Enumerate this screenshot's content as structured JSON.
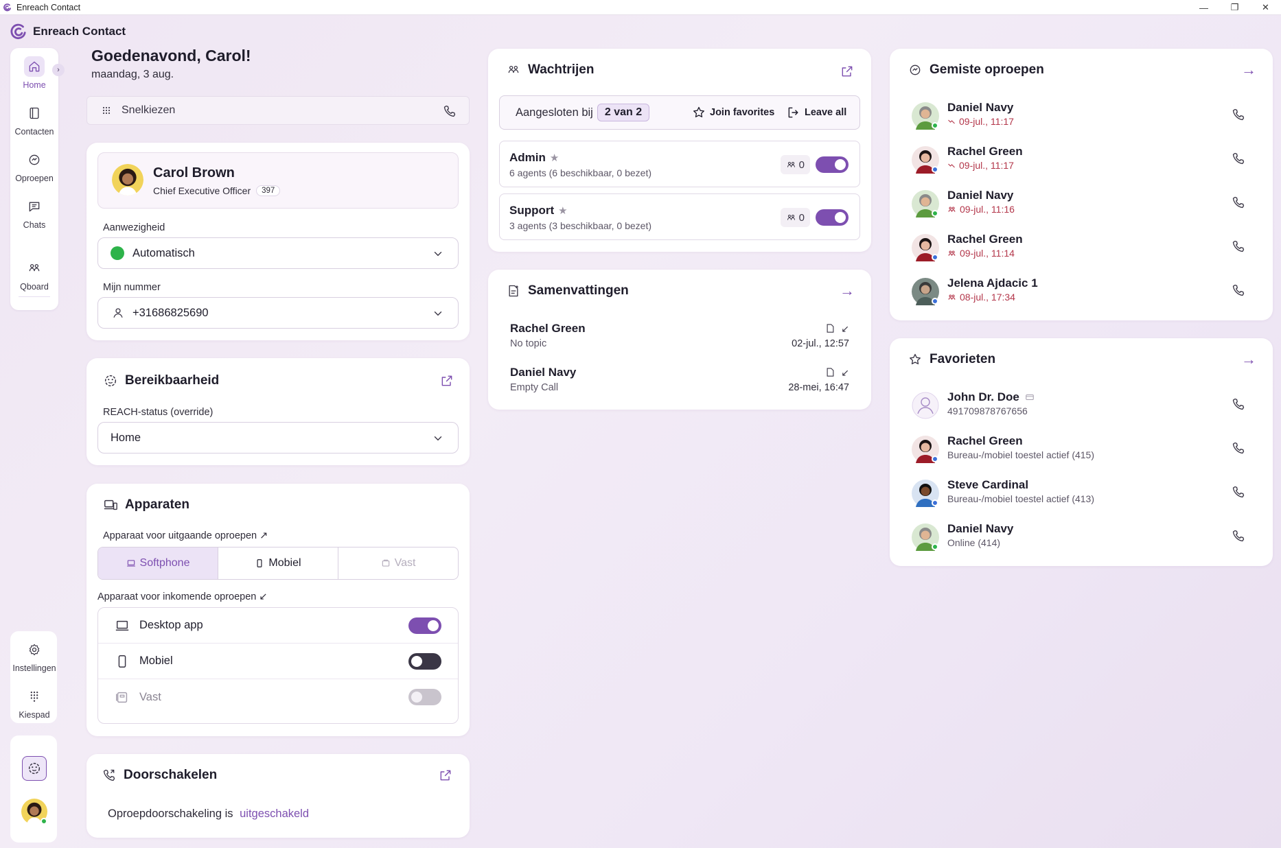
{
  "window": {
    "title": "Enreach Contact"
  },
  "brand": {
    "name": "Enreach Contact"
  },
  "nav": {
    "items": [
      {
        "label": "Home",
        "icon": "home-icon"
      },
      {
        "label": "Contacten",
        "icon": "contacts-icon"
      },
      {
        "label": "Oproepen",
        "icon": "calls-icon"
      },
      {
        "label": "Chats",
        "icon": "chat-icon"
      },
      {
        "label": "Qboard",
        "icon": "qboard-icon"
      }
    ],
    "bottom": [
      {
        "label": "Instellingen",
        "icon": "gear-icon"
      },
      {
        "label": "Kiespad",
        "icon": "keypad-icon"
      }
    ]
  },
  "greeting": {
    "title": "Goedenavond, Carol!",
    "date": "maandag, 3 aug."
  },
  "quickdial": {
    "label": "Snelkiezen"
  },
  "profile": {
    "name": "Carol Brown",
    "role": "Chief Executive Officer",
    "extension": "397",
    "presence_label": "Aanwezigheid",
    "presence_value": "Automatisch",
    "number_label": "Mijn nummer",
    "number_value": "+31686825690"
  },
  "reachability": {
    "title": "Bereikbaarheid",
    "status_label": "REACH-status (override)",
    "status_value": "Home"
  },
  "devices": {
    "title": "Apparaten",
    "outgoing_label": "Apparaat voor uitgaande oproepen ↗",
    "outgoing_options": [
      "Softphone",
      "Mobiel",
      "Vast"
    ],
    "incoming_label": "Apparaat voor inkomende oproepen ↙",
    "incoming": [
      {
        "label": "Desktop app",
        "state": "on"
      },
      {
        "label": "Mobiel",
        "state": "off"
      },
      {
        "label": "Vast",
        "state": "disabled"
      }
    ]
  },
  "forwarding": {
    "title": "Doorschakelen",
    "text": "Oproepdoorschakeling is",
    "status": "uitgeschakeld"
  },
  "queues": {
    "title": "Wachtrijen",
    "joined_label": "Aangesloten bij",
    "joined_count": "2 van 2",
    "join_favorites": "Join favorites",
    "leave_all": "Leave all",
    "items": [
      {
        "name": "Admin",
        "summary": "6 agents (6 beschikbaar, 0 bezet)",
        "waiting": "0",
        "on": true
      },
      {
        "name": "Support",
        "summary": "3 agents (3 beschikbaar, 0 bezet)",
        "waiting": "0",
        "on": true
      }
    ]
  },
  "summaries": {
    "title": "Samenvattingen",
    "items": [
      {
        "name": "Rachel Green",
        "topic": "No topic",
        "date": "02-jul., 12:57"
      },
      {
        "name": "Daniel Navy",
        "topic": "Empty Call",
        "date": "28-mei, 16:47"
      }
    ]
  },
  "missed": {
    "title": "Gemiste oproepen",
    "items": [
      {
        "name": "Daniel Navy",
        "time": "09-jul., 11:17",
        "kind": "direct",
        "avatar": "daniel",
        "dot": "#2db34a"
      },
      {
        "name": "Rachel Green",
        "time": "09-jul., 11:17",
        "kind": "direct",
        "avatar": "rachel",
        "dot": "#3b6fd8"
      },
      {
        "name": "Daniel Navy",
        "time": "09-jul., 11:16",
        "kind": "queue",
        "avatar": "daniel",
        "dot": "#2db34a"
      },
      {
        "name": "Rachel Green",
        "time": "09-jul., 11:14",
        "kind": "queue",
        "avatar": "rachel",
        "dot": "#3b6fd8"
      },
      {
        "name": "Jelena Ajdacic 1",
        "time": "08-jul., 17:34",
        "kind": "queue",
        "avatar": "jelena",
        "dot": "#3b6fd8"
      }
    ]
  },
  "favorites": {
    "title": "Favorieten",
    "items": [
      {
        "name": "John Dr. Doe",
        "sub": "491709878767656",
        "avatar": "placeholder",
        "dot": ""
      },
      {
        "name": "Rachel Green",
        "sub": "Bureau-/mobiel toestel actief (415)",
        "avatar": "rachel",
        "dot": "#3b6fd8"
      },
      {
        "name": "Steve Cardinal",
        "sub": "Bureau-/mobiel toestel actief (413)",
        "avatar": "steve",
        "dot": "#3b6fd8"
      },
      {
        "name": "Daniel Navy",
        "sub": "Online (414)",
        "avatar": "daniel",
        "dot": "#2db34a"
      }
    ]
  },
  "colors": {
    "accent": "#7d4fb0",
    "online": "#2db34a",
    "busy": "#3b6fd8",
    "missed": "#b3364a"
  }
}
